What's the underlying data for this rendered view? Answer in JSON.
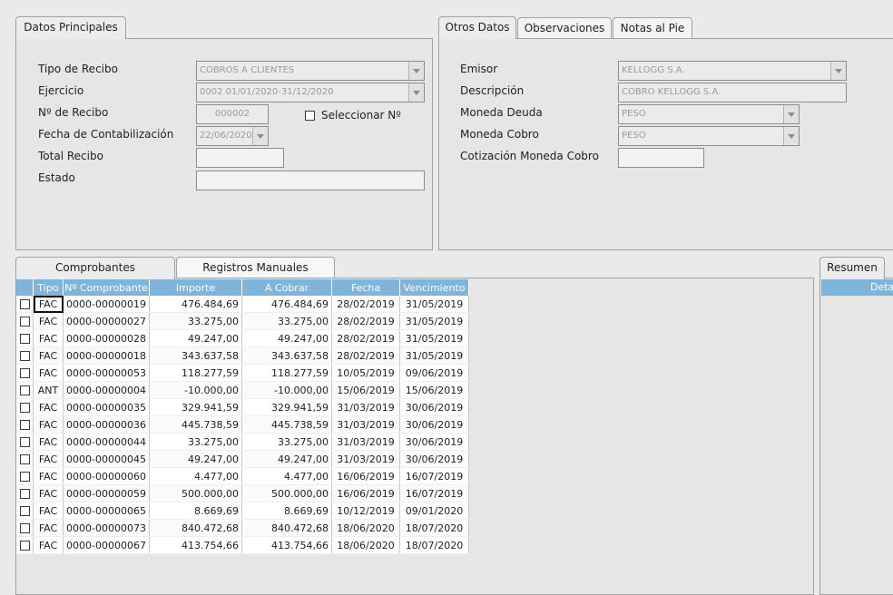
{
  "left_panel": {
    "tab": "Datos Principales",
    "labels": {
      "tipo": "Tipo de Recibo",
      "ejercicio": "Ejercicio",
      "nro": "Nº de Recibo",
      "fecha": "Fecha de Contabilización",
      "total": "Total Recibo",
      "estado": "Estado"
    },
    "values": {
      "tipo": "COBROS A CLIENTES",
      "ejercicio": "0002 01/01/2020-31/12/2020",
      "nro": "000002",
      "fecha": "22/06/2020",
      "total": "",
      "estado": ""
    },
    "seleccionar_label": "Seleccionar Nº"
  },
  "right_panel": {
    "tabs": [
      "Otros Datos",
      "Observaciones",
      "Notas al Pie"
    ],
    "labels": {
      "emisor": "Emisor",
      "descripcion": "Descripción",
      "moneda_deuda": "Moneda Deuda",
      "moneda_cobro": "Moneda Cobro",
      "cotizacion": "Cotización Moneda Cobro"
    },
    "values": {
      "emisor": "KELLOGG S.A.",
      "descripcion": "COBRO KELLOGG S.A.",
      "moneda_deuda": "PESO",
      "moneda_cobro": "PESO",
      "cotizacion": ""
    }
  },
  "lower_tabs": [
    "Comprobantes",
    "Registros Manuales"
  ],
  "grid": {
    "columns": [
      "Tipo",
      "Nº Comprobante",
      "Importe",
      "A Cobrar",
      "Fecha",
      "Vencimiento"
    ],
    "rows": [
      [
        "FAC",
        "0000-00000019",
        "476.484,69",
        "476.484,69",
        "28/02/2019",
        "31/05/2019"
      ],
      [
        "FAC",
        "0000-00000027",
        "33.275,00",
        "33.275,00",
        "28/02/2019",
        "31/05/2019"
      ],
      [
        "FAC",
        "0000-00000028",
        "49.247,00",
        "49.247,00",
        "28/02/2019",
        "31/05/2019"
      ],
      [
        "FAC",
        "0000-00000018",
        "343.637,58",
        "343.637,58",
        "28/02/2019",
        "31/05/2019"
      ],
      [
        "FAC",
        "0000-00000053",
        "118.277,59",
        "118.277,59",
        "10/05/2019",
        "09/06/2019"
      ],
      [
        "ANT",
        "0000-00000004",
        "-10.000,00",
        "-10.000,00",
        "15/06/2019",
        "15/06/2019"
      ],
      [
        "FAC",
        "0000-00000035",
        "329.941,59",
        "329.941,59",
        "31/03/2019",
        "30/06/2019"
      ],
      [
        "FAC",
        "0000-00000036",
        "445.738,59",
        "445.738,59",
        "31/03/2019",
        "30/06/2019"
      ],
      [
        "FAC",
        "0000-00000044",
        "33.275,00",
        "33.275,00",
        "31/03/2019",
        "30/06/2019"
      ],
      [
        "FAC",
        "0000-00000045",
        "49.247,00",
        "49.247,00",
        "31/03/2019",
        "30/06/2019"
      ],
      [
        "FAC",
        "0000-00000060",
        "4.477,00",
        "4.477,00",
        "16/06/2019",
        "16/07/2019"
      ],
      [
        "FAC",
        "0000-00000059",
        "500.000,00",
        "500.000,00",
        "16/06/2019",
        "16/07/2019"
      ],
      [
        "FAC",
        "0000-00000065",
        "8.669,69",
        "8.669,69",
        "10/12/2019",
        "09/01/2020"
      ],
      [
        "FAC",
        "0000-00000073",
        "840.472,68",
        "840.472,68",
        "18/06/2020",
        "18/07/2020"
      ],
      [
        "FAC",
        "0000-00000067",
        "413.754,66",
        "413.754,66",
        "18/06/2020",
        "18/07/2020"
      ]
    ]
  },
  "resumen": {
    "tab": "Resumen",
    "header": "Detal"
  },
  "colors": {
    "grid_header": "#7fb4db",
    "background": "#eaeaea"
  }
}
